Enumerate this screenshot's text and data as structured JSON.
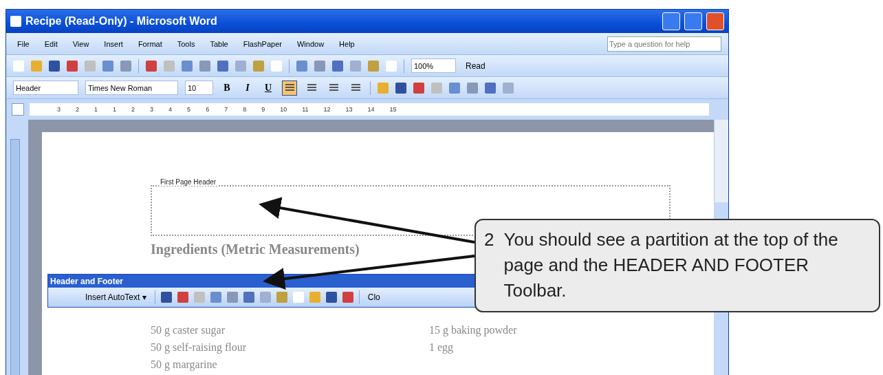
{
  "window": {
    "title": "Recipe (Read-Only) - Microsoft Word"
  },
  "menu": [
    "File",
    "Edit",
    "View",
    "Insert",
    "Format",
    "Tools",
    "Table",
    "FlashPaper",
    "Window",
    "Help"
  ],
  "help_box": {
    "placeholder": "Type a question for help"
  },
  "standard_toolbar": {
    "zoom": "100%",
    "read_button": "Read"
  },
  "formatting_toolbar": {
    "style": "Header",
    "font": "Times New Roman",
    "size": "10",
    "bold": "B",
    "italic": "I",
    "underline": "U",
    "alignment": [
      {
        "selected": true
      },
      {
        "selected": false
      },
      {
        "selected": false
      },
      {
        "selected": false
      }
    ]
  },
  "ruler": [
    "3",
    "2",
    "1",
    "1",
    "2",
    "3",
    "4",
    "5",
    "6",
    "7",
    "8",
    "9",
    "10",
    "11",
    "12",
    "13",
    "14",
    "15"
  ],
  "document": {
    "header_label": "First Page Header",
    "heading": "Ingredients (Metric Measurements)",
    "ingredients": [
      [
        "50 g caster sugar",
        "50 g self-raising flour",
        "50 g margarine"
      ],
      [
        "15 g baking powder",
        "1 egg"
      ]
    ]
  },
  "header_footer_toolbar": {
    "title": "Header and Footer",
    "insert_autotext": "Insert AutoText",
    "insert_autotext_caret": "▾",
    "close": "Clo"
  },
  "callout": {
    "number": "2",
    "text": "You should see a partition at the top of the page and the HEADER AND FOOTER Toolbar."
  }
}
